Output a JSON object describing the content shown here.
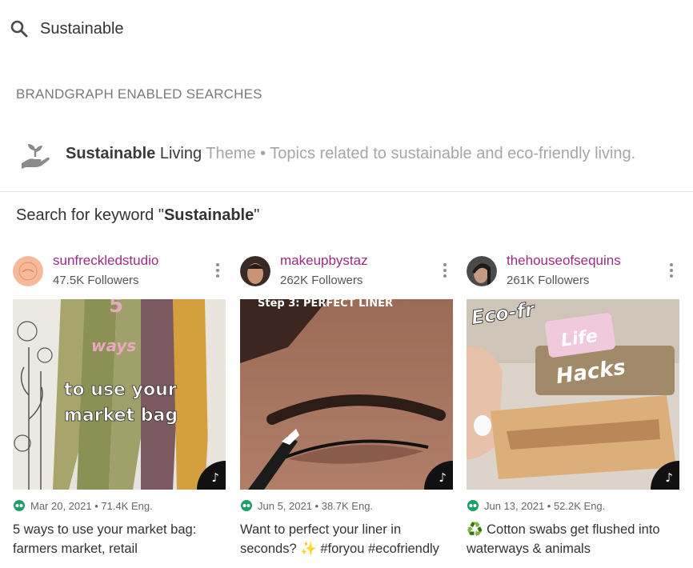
{
  "search": {
    "value": "Sustainable"
  },
  "brandgraph": {
    "section_title": "BRANDGRAPH ENABLED SEARCHES",
    "suggestion": {
      "match": "Sustainable",
      "rest": " Living",
      "description": "Theme • Topics related to sustainable and eco-friendly living."
    }
  },
  "keyword_search": {
    "prefix": "Search for keyword \"",
    "keyword": "Sustainable",
    "suffix": "\""
  },
  "results": [
    {
      "handle": "sunfreckledstudio",
      "followers": "47.5K Followers",
      "overlay": [
        "5",
        "ways",
        "to use your",
        "market bag"
      ],
      "meta": "Mar 20, 2021 • 71.4K Eng.",
      "caption": "5 ways to use your market bag: farmers market, retail"
    },
    {
      "handle": "makeupbystaz",
      "followers": "262K Followers",
      "overlay": [
        "Step 3: PERFECT LINER"
      ],
      "meta": "Jun 5, 2021 • 38.7K Eng.",
      "caption": "Want to perfect your liner in seconds? ✨  #foryou #ecofriendly"
    },
    {
      "handle": "thehouseofsequins",
      "followers": "261K Followers",
      "overlay": [
        "Eco-fr",
        "Life",
        "Hacks"
      ],
      "meta": "Jun 13, 2021 • 52.2K Eng.",
      "caption": "♻️ Cotton swabs get flushed into waterways & animals"
    }
  ],
  "colors": {
    "handle": "#9b2b86",
    "muted": "#a6a6a6",
    "meta_icon": "#1f9e6a"
  },
  "icons": [
    "search-icon",
    "plant-hand-icon",
    "more-vert-icon",
    "tiktok-icon",
    "engagement-icon"
  ]
}
